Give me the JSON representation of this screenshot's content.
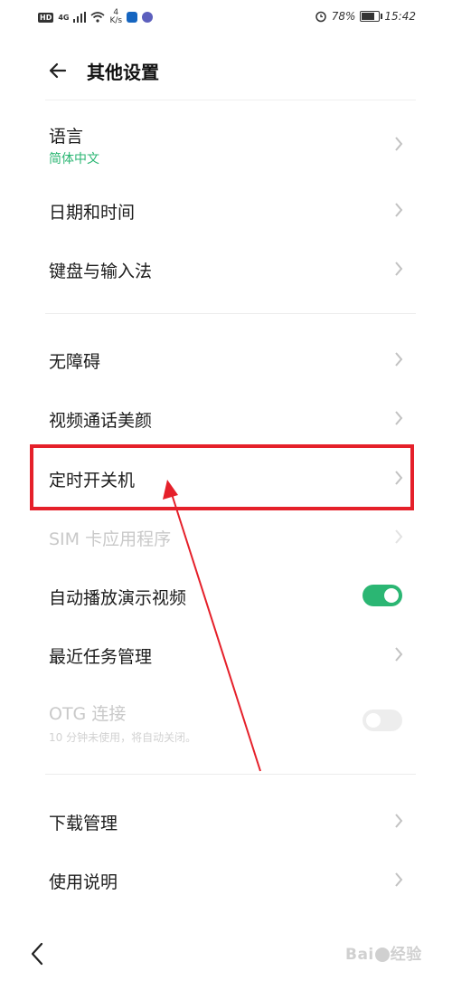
{
  "status_bar": {
    "network": "HD",
    "signal": "4G",
    "speed_value": "4",
    "speed_unit": "K/s",
    "battery_percent": "78%",
    "battery_level": 0.78,
    "time": "15:42"
  },
  "header": {
    "back_icon": "arrow-left-icon",
    "title": "其他设置"
  },
  "settings": {
    "language": {
      "label": "语言",
      "value": "简体中文"
    },
    "date_time": {
      "label": "日期和时间"
    },
    "keyboard": {
      "label": "键盘与输入法"
    },
    "accessibility": {
      "label": "无障碍"
    },
    "video_beauty": {
      "label": "视频通话美颜"
    },
    "scheduled_power": {
      "label": "定时开关机"
    },
    "sim_apps": {
      "label": "SIM 卡应用程序"
    },
    "autoplay_demo": {
      "label": "自动播放演示视频",
      "enabled": true
    },
    "recent_tasks": {
      "label": "最近任务管理"
    },
    "otg": {
      "label": "OTG 连接",
      "description": "10 分钟未使用，将自动关闭。",
      "enabled": false
    },
    "downloads": {
      "label": "下载管理"
    },
    "instructions": {
      "label": "使用说明"
    }
  },
  "watermark": {
    "text_left": "Bai",
    "text_right": "经验"
  },
  "colors": {
    "accent": "#2bb673",
    "annotation": "#e5202a"
  }
}
